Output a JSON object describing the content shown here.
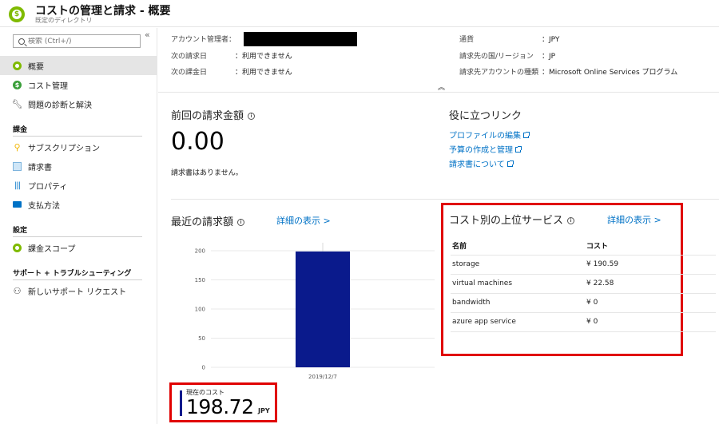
{
  "header": {
    "title": "コストの管理と請求 - 概要",
    "subtitle": "既定のディレクトリ"
  },
  "sidebar": {
    "search_placeholder": "検索 (Ctrl+/)",
    "collapse_glyph": "«",
    "items": [
      {
        "label": "概要",
        "icon": "overview-icon",
        "active": true
      },
      {
        "label": "コスト管理",
        "icon": "dollar-icon"
      },
      {
        "label": "問題の診断と解決",
        "icon": "wrench-icon"
      }
    ],
    "billing": {
      "heading": "課金",
      "items": [
        {
          "label": "サブスクリプション",
          "icon": "key-icon"
        },
        {
          "label": "請求書",
          "icon": "document-icon"
        },
        {
          "label": "プロパティ",
          "icon": "properties-icon"
        },
        {
          "label": "支払方法",
          "icon": "credit-card-icon"
        }
      ]
    },
    "settings": {
      "heading": "設定",
      "items": [
        {
          "label": "課金スコープ",
          "icon": "scope-icon"
        }
      ]
    },
    "support": {
      "heading": "サポート + トラブルシューティング",
      "items": [
        {
          "label": "新しいサポート リクエスト",
          "icon": "support-person-icon"
        }
      ]
    }
  },
  "essentials": {
    "account_admin_label": "アカウント管理者：",
    "next_bill_label": "次の請求日",
    "next_bill_value": "：利用できません",
    "next_charge_label": "次の課金日",
    "next_charge_value": "：利用できません",
    "currency_label": "通貨",
    "currency_value": "：JPY",
    "region_label": "請求先の国/リージョン",
    "region_value": "：JP",
    "account_type_label": "請求先アカウントの種類",
    "account_type_value": "：Microsoft Online Services プログラム",
    "expand_glyph": "︽"
  },
  "previous_bill": {
    "title": "前回の請求金額",
    "amount": "0.00",
    "note": "請求書はありません。"
  },
  "useful_links": {
    "title": "役に立つリンク",
    "links": [
      "プロファイルの編集",
      "予算の作成と管理",
      "請求書について"
    ]
  },
  "recent_bills": {
    "title": "最近の請求額",
    "details_link": "詳細の表示 >",
    "current_cost_label": "現在のコスト",
    "current_cost_value": "198.72",
    "current_cost_unit": "JPY"
  },
  "chart_data": {
    "type": "bar",
    "categories": [
      "2019/12/7"
    ],
    "values": [
      198.72
    ],
    "ylim": [
      0,
      200
    ],
    "yticks": [
      0,
      50,
      100,
      150,
      200
    ],
    "bar_color": "#0a1a8c",
    "grid": true
  },
  "top_services": {
    "title": "コスト別の上位サービス",
    "details_link": "詳細の表示 >",
    "columns": [
      "名前",
      "コスト"
    ],
    "rows": [
      [
        "storage",
        "¥ 190.59"
      ],
      [
        "virtual machines",
        "¥ 22.58"
      ],
      [
        "bandwidth",
        "¥ 0"
      ],
      [
        "azure app service",
        "¥ 0"
      ]
    ]
  },
  "colors": {
    "accent": "#0072c6",
    "highlight_border": "#e00000",
    "bar": "#0a1a8c"
  }
}
